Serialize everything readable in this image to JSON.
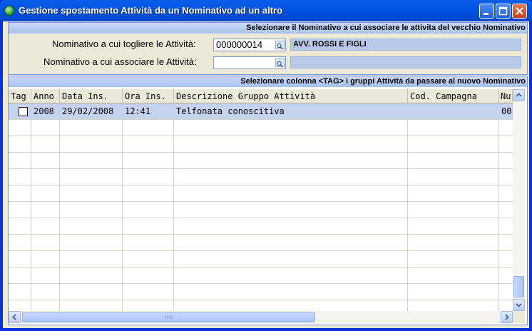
{
  "window": {
    "title": "Gestione spostamento Attività da un Nominativo ad un altro"
  },
  "section_from": {
    "header": "Selezionare il Nominativo a cui associare le attivita del vecchio Nominativo",
    "from_label": "Nominativo a cui togliere le Attività:",
    "from_code": "000000014",
    "from_name": "AVV. ROSSI E FIGLI",
    "to_label": "Nominativo a cui associare le Attività:",
    "to_code": "",
    "to_name": ""
  },
  "section_grid": {
    "header": "Selezionare colonna <TAG> i gruppi Attività da passare al nuovo Nominativo",
    "columns": [
      "Tag",
      "Anno",
      "Data Ins.",
      "Ora Ins.",
      "Descrizione Gruppo Attività",
      "Cod. Campagna",
      "Nu"
    ],
    "rows": [
      {
        "tag": false,
        "anno": "2008",
        "data": "29/02/2008",
        "ora": "12:41",
        "descrizione": "Telfonata conoscitiva",
        "campagna": "",
        "nu": "00"
      }
    ]
  },
  "icons": {
    "app": "app-status-icon",
    "lookup": "lookup-icon"
  },
  "colors": {
    "title_bar": "#0055e5",
    "section_header": "#a9c2f0",
    "selected_row": "#c5d3ee"
  }
}
